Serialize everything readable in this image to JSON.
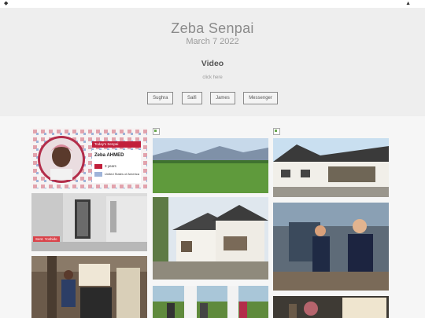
{
  "topbar": {
    "left_icon": "◆",
    "right_icon": "▲"
  },
  "header": {
    "title": "Zeba Senpai",
    "date": "March 7 2022",
    "section": "Video",
    "link": "click here",
    "buttons": [
      "Sughra",
      "Saifi",
      "James",
      "Messenger"
    ]
  },
  "card": {
    "banner": "Today's Senpai",
    "name": "Zeba AHMED",
    "years": "3 years",
    "country": "United States of America"
  },
  "tag": "Sent. Yoshido"
}
